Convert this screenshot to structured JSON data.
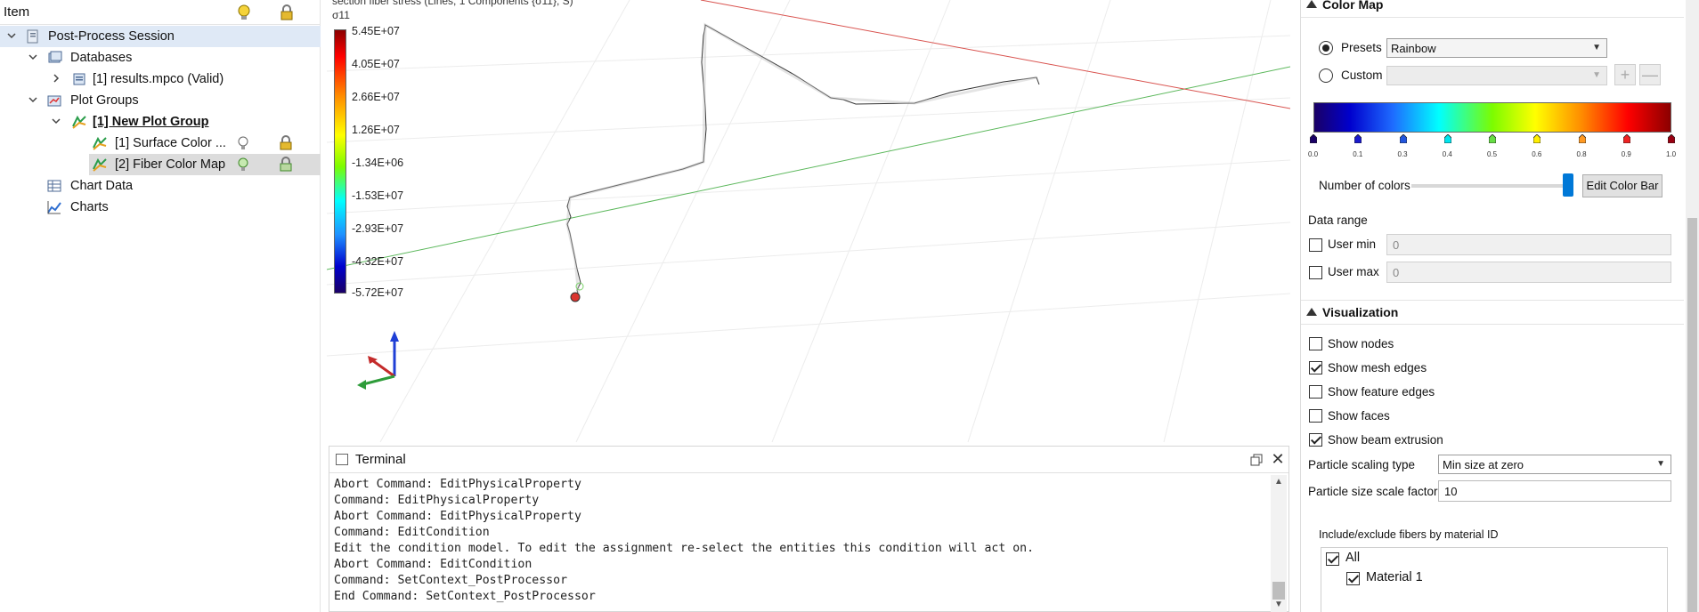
{
  "tree": {
    "header_title": "Item",
    "rows": {
      "session": "Post-Process Session",
      "databases": "Databases",
      "results": "[1] results.mpco (Valid)",
      "plot_groups": "Plot Groups",
      "new_plot_group": "[1] New Plot Group",
      "surface_color": "[1] Surface Color ...",
      "fiber_color_map": "[2] Fiber Color Map",
      "chart_data": "Chart Data",
      "charts": "Charts"
    }
  },
  "viewport": {
    "scalar_title": "section fiber stress (Lines, 1 Components {σ11}, S)",
    "component": "σ11",
    "colorbar_labels": [
      "5.45E+07",
      "4.05E+07",
      "2.66E+07",
      "1.26E+07",
      "-1.34E+06",
      "-1.53E+07",
      "-2.93E+07",
      "-4.32E+07",
      "-5.72E+07"
    ]
  },
  "terminal": {
    "title": "Terminal",
    "lines": [
      "Abort Command: EditPhysicalProperty",
      "Command: EditPhysicalProperty",
      "Abort Command: EditPhysicalProperty",
      "Command: EditCondition",
      "Edit the condition model. To edit the assignment re-select the entities this condition will act on.",
      "Abort Command: EditCondition",
      "Command: SetContext_PostProcessor",
      "End Command: SetContext_PostProcessor"
    ]
  },
  "props": {
    "color_map": {
      "section_title": "Color Map",
      "presets_label": "Presets",
      "presets_value": "Rainbow",
      "custom_label": "Custom",
      "custom_value": "",
      "add_symbol": "+",
      "remove_symbol": "—",
      "ticks": [
        "0.0",
        "0.1",
        "0.3",
        "0.4",
        "0.5",
        "0.6",
        "0.8",
        "0.9",
        "1.0"
      ],
      "marker_colors": [
        "#1a0066",
        "#1a1acc",
        "#2255dd",
        "#00e5ee",
        "#66dd44",
        "#ffee00",
        "#ff9922",
        "#ee2222",
        "#990011"
      ],
      "number_of_colors_label": "Number of colors",
      "edit_color_bar_label": "Edit Color Bar",
      "data_range_label": "Data range",
      "user_min_label": "User min",
      "user_min_value": "0",
      "user_max_label": "User max",
      "user_max_value": "0"
    },
    "visualization": {
      "section_title": "Visualization",
      "show_nodes": "Show nodes",
      "show_mesh_edges": "Show mesh edges",
      "show_feature_edges": "Show feature edges",
      "show_faces": "Show faces",
      "show_beam_extrusion": "Show beam extrusion",
      "particle_scaling_type_label": "Particle scaling type",
      "particle_scaling_type_value": "Min size at zero",
      "particle_size_scale_factor_label": "Particle size scale factor",
      "particle_size_scale_factor_value": "10",
      "fiber_filter_label": "Include/exclude fibers by material ID",
      "fiber_all": "All",
      "fiber_material_1": "Material 1"
    }
  }
}
